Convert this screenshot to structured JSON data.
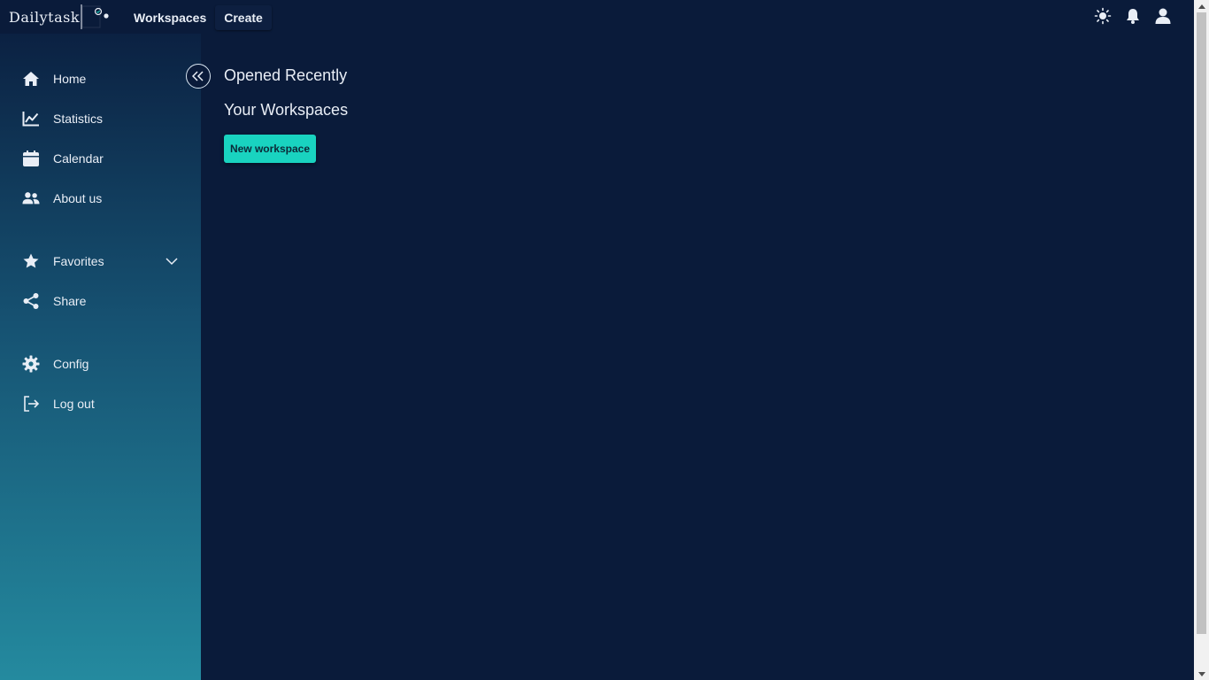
{
  "header": {
    "logo_text": "Dailytask",
    "nav": [
      {
        "label": "Workspaces"
      },
      {
        "label": "Create"
      }
    ],
    "icons": [
      "sun-icon",
      "bell-icon",
      "user-icon"
    ]
  },
  "sidebar": {
    "items": [
      {
        "label": "Home",
        "icon": "home-icon"
      },
      {
        "label": "Statistics",
        "icon": "chart-line-icon"
      },
      {
        "label": "Calendar",
        "icon": "calendar-icon"
      },
      {
        "label": "About us",
        "icon": "users-icon"
      },
      {
        "label": "Favorites",
        "icon": "star-icon",
        "expandable": true
      },
      {
        "label": "Share",
        "icon": "share-icon"
      },
      {
        "label": "Config",
        "icon": "gear-icon"
      },
      {
        "label": "Log out",
        "icon": "logout-icon"
      }
    ]
  },
  "main": {
    "opened_recently_title": "Opened Recently",
    "your_workspaces_title": "Your Workspaces",
    "new_workspace_label": "New workspace"
  },
  "colors": {
    "background": "#0a1b3a",
    "accent": "#19d3c0",
    "sidebar_top": "#0b2142",
    "sidebar_bottom": "#248a9f"
  }
}
